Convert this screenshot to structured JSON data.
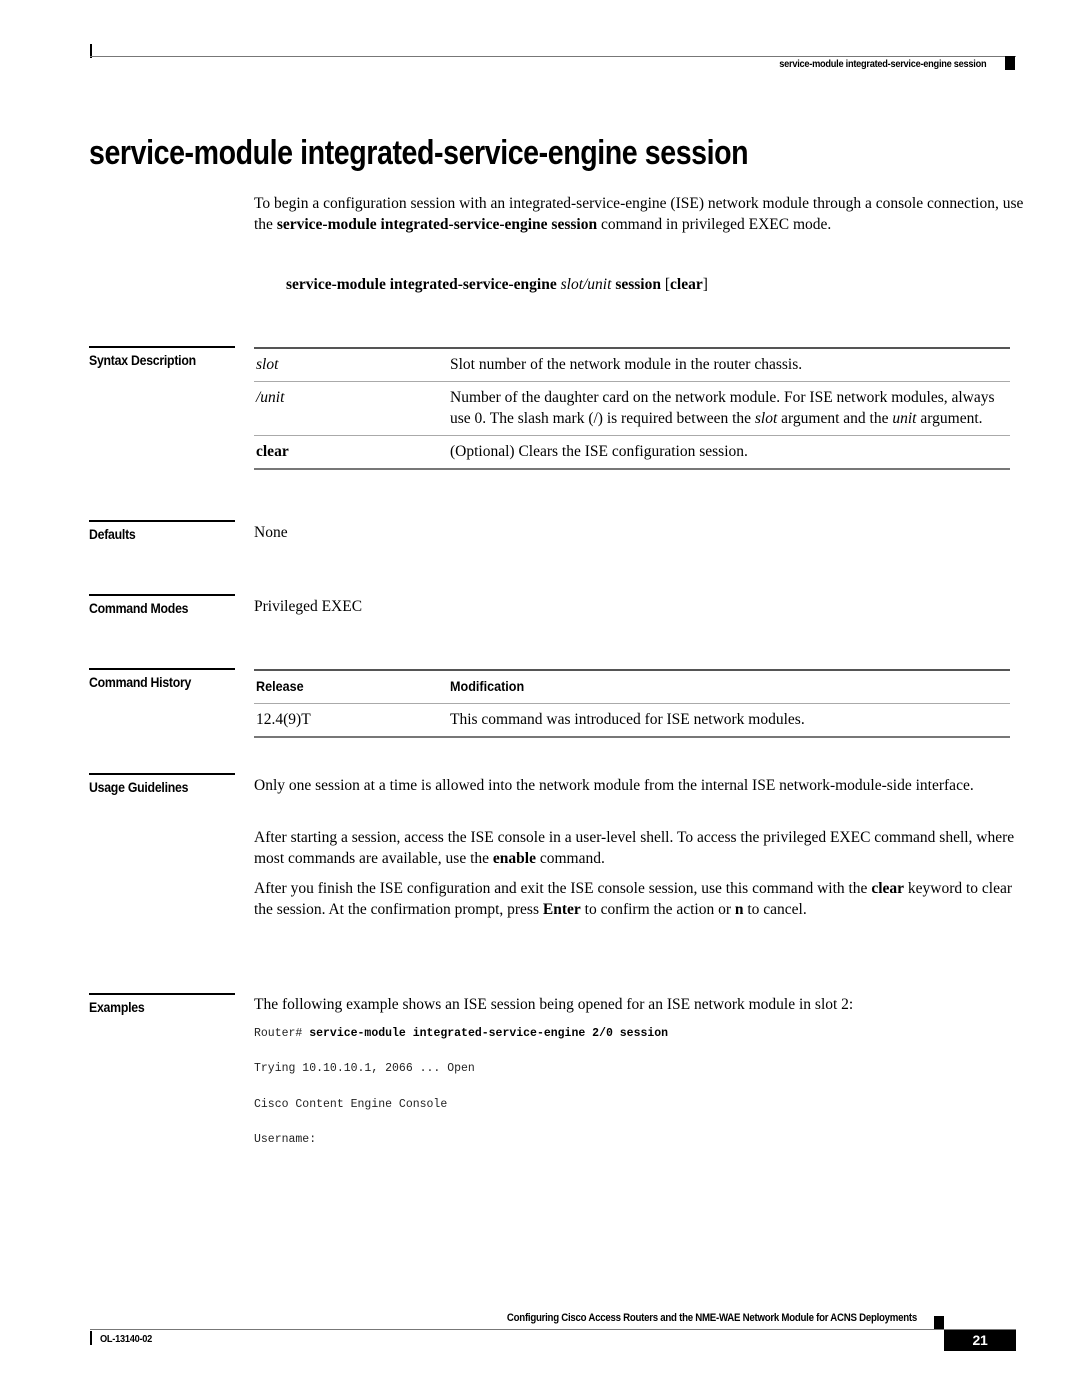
{
  "header": {
    "running_title": "service-module integrated-service-engine session"
  },
  "title": "service-module integrated-service-engine session",
  "intro": {
    "text_before": "To begin a configuration session with an integrated-service-engine (ISE) network module through a console connection, use the ",
    "command_bold": "service-module integrated-service-engine session",
    "text_after": " command in privileged EXEC mode."
  },
  "syntax": {
    "cmd_bold": "service-module integrated-service-engine ",
    "arg_italic": "slot/unit",
    "cmd_bold2": " session",
    "opt_open": " [",
    "opt_bold": "clear",
    "opt_close": "]"
  },
  "sections": {
    "syntax_description": {
      "label": "Syntax Description",
      "rows": [
        {
          "term": "slot",
          "style": "italic",
          "desc": "Slot number of the network module in the router chassis."
        },
        {
          "term": "/unit",
          "style": "italic",
          "desc_parts": [
            "Number of the daughter card on the network module. For ISE network modules, always use 0. The slash mark (/) is required between the ",
            "slot",
            " argument and the ",
            "unit",
            " argument."
          ]
        },
        {
          "term": "clear",
          "style": "bold",
          "desc": "(Optional) Clears the ISE configuration session."
        }
      ]
    },
    "defaults": {
      "label": "Defaults",
      "value": "None"
    },
    "command_modes": {
      "label": "Command Modes",
      "value": "Privileged EXEC"
    },
    "command_history": {
      "label": "Command History",
      "columns": [
        "Release",
        "Modification"
      ],
      "rows": [
        {
          "release": "12.4(9)T",
          "modification": "This command was introduced for ISE network modules."
        }
      ]
    },
    "usage_guidelines": {
      "label": "Usage Guidelines",
      "p1": "Only one session at a time is allowed into the network module from the internal ISE network-module-side interface.",
      "p2_before": "After starting a session, access the ISE console in a user-level shell. To access the privileged EXEC command shell, where most commands are available, use the ",
      "p2_bold": "enable",
      "p2_after": " command.",
      "p3_a": "After you finish the ISE configuration and exit the ISE console session, use this command with the ",
      "p3_b": "clear",
      "p3_c": " keyword to clear the session. At the confirmation prompt, press ",
      "p3_d": "Enter",
      "p3_e": " to confirm the action or ",
      "p3_f": "n",
      "p3_g": " to cancel."
    },
    "examples": {
      "label": "Examples",
      "intro": "The following example shows an ISE session being opened for an ISE network module in slot 2:",
      "prompt": "Router# ",
      "command": "service-module integrated-service-engine 2/0 session",
      "line2": "Trying 10.10.10.1, 2066 ... Open",
      "line3": "Cisco Content Engine Console",
      "line4": "Username:"
    }
  },
  "footer": {
    "book_title": "Configuring Cisco Access Routers and the NME-WAE Network Module for ACNS Deployments",
    "doc_number": "OL-13140-02",
    "page_number": "21"
  }
}
